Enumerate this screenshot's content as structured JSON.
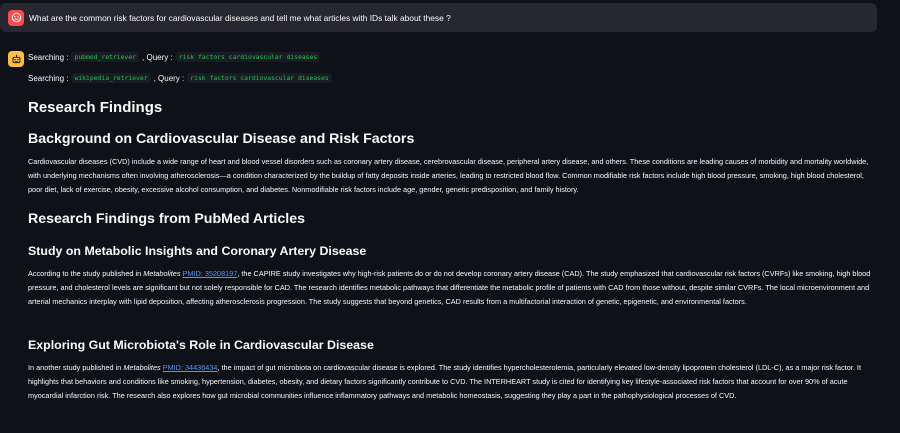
{
  "user_message": {
    "text": "What are the common risk factors for cardiovascular diseases and tell me what articles with IDs talk about these ?",
    "avatar_icon": "smiley-face-icon",
    "avatar_color": "#ff4b4b"
  },
  "assistant": {
    "avatar_icon": "robot-icon",
    "avatar_color": "#ffbd45",
    "searches": [
      {
        "prefix": "Searching :",
        "tool": "pubmed_retriever",
        "query_label": ", Query :",
        "query": "risk factors cardiovascular diseases"
      },
      {
        "prefix": "Searching :",
        "tool": "wikipedia_retriever",
        "query_label": ", Query :",
        "query": "risk factors cardiovascular diseases"
      }
    ],
    "title": "Research Findings",
    "background": {
      "heading": "Background on Cardiovascular Disease and Risk Factors",
      "text": "Cardiovascular diseases (CVD) include a wide range of heart and blood vessel disorders such as coronary artery disease, cerebrovascular disease, peripheral artery disease, and others. These conditions are leading causes of morbidity and mortality worldwide, with underlying mechanisms often involving atherosclerosis—a condition characterized by the buildup of fatty deposits inside arteries, leading to restricted blood flow. Common modifiable risk factors include high blood pressure, smoking, high blood cholesterol, poor diet, lack of exercise, obesity, excessive alcohol consumption, and diabetes. Nonmodifiable risk factors include age, gender, genetic predisposition, and family history."
    },
    "pubmed_heading": "Research Findings from PubMed Articles",
    "studies": [
      {
        "heading": "Study on Metabolic Insights and Coronary Artery Disease",
        "lead": "According to the study published in ",
        "journal": "Metabolites",
        "pmid": "PMID: 35208197",
        "rest": ", the CAPIRE study investigates why high-risk patients do or do not develop coronary artery disease (CAD). The study emphasized that cardiovascular risk factors (CVRFs) like smoking, high blood pressure, and cholesterol levels are significant but not solely responsible for CAD. The research identifies metabolic pathways that differentiate the metabolic profile of patients with CAD from those without, despite similar CVRFs. The local microenvironment and arterial mechanics interplay with lipid deposition, affecting atherosclerosis progression. The study suggests that beyond genetics, CAD results from a multifactorial interaction of genetic, epigenetic, and environmental factors."
      },
      {
        "heading": "Exploring Gut Microbiota's Role in Cardiovascular Disease",
        "lead": "In another study published in ",
        "journal": "Metabolites",
        "pmid": "PMID: 34436434",
        "rest": ", the impact of gut microbiota on cardiovascular disease is explored. The study identifies hypercholesterolemia, particularly elevated low-density lipoprotein cholesterol (LDL-C), as a major risk factor. It highlights that behaviors and conditions like smoking, hypertension, diabetes, obesity, and dietary factors significantly contribute to CVD. The INTERHEART study is cited for identifying key lifestyle-associated risk factors that account for over 90% of acute myocardial infarction risk. The research also explores how gut microbial communities influence inflammatory pathways and metabolic homeostasis, suggesting they play a part in the pathophysiological processes of CVD."
      }
    ]
  }
}
